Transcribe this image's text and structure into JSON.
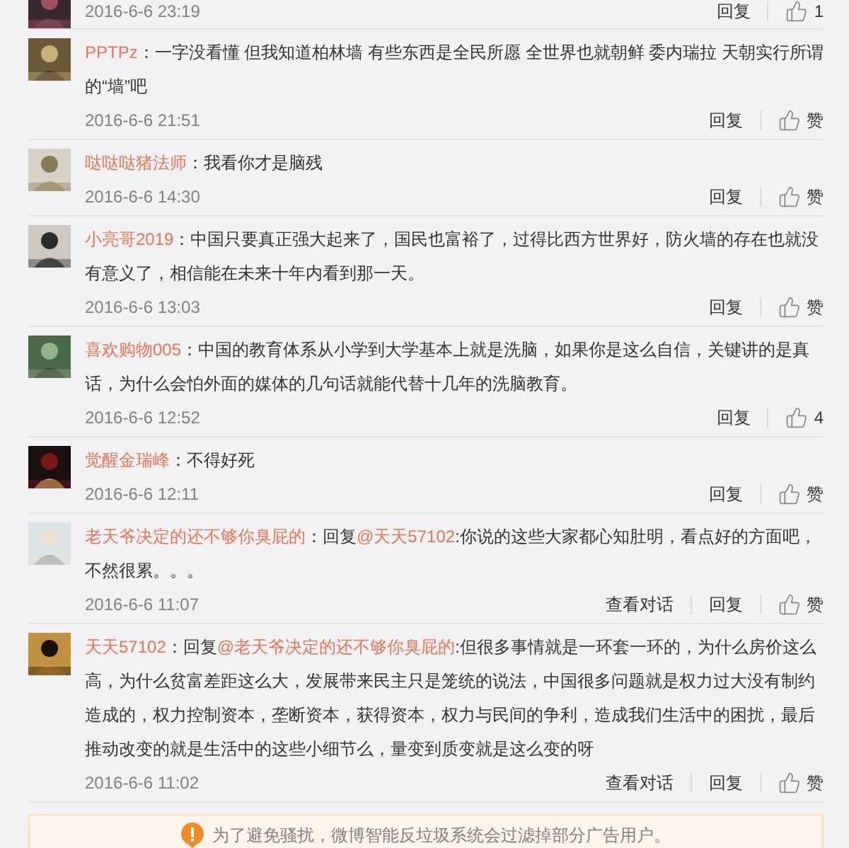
{
  "partial_comment": {
    "date": "2016-6-6 23:19",
    "reply": "回复",
    "like": "1"
  },
  "comments": [
    {
      "name": "PPTPz",
      "segments": [
        {
          "kind": "text",
          "text": "：一字没看懂 但我知道柏林墙 有些东西是全民所愿  全世界也就朝鲜 委内瑞拉 天朝实行所谓的“墙”吧"
        }
      ],
      "date": "2016-6-6 21:51",
      "reply": "回复",
      "like": "赞"
    },
    {
      "name": "哒哒哒猪法师",
      "segments": [
        {
          "kind": "text",
          "text": "：我看你才是脑残"
        }
      ],
      "date": "2016-6-6 14:30",
      "reply": "回复",
      "like": "赞"
    },
    {
      "name": "小亮哥2019",
      "segments": [
        {
          "kind": "text",
          "text": "：中国只要真正强大起来了，国民也富裕了，过得比西方世界好，防火墙的存在也就没有意义了，相信能在未来十年内看到那一天。"
        }
      ],
      "date": "2016-6-6 13:03",
      "reply": "回复",
      "like": "赞"
    },
    {
      "name": "喜欢购物005",
      "segments": [
        {
          "kind": "text",
          "text": "：中国的教育体系从小学到大学基本上就是洗脑，如果你是这么自信，关键讲的是真话，为什么会怕外面的媒体的几句话就能代替十几年的洗脑教育。"
        }
      ],
      "date": "2016-6-6 12:52",
      "reply": "回复",
      "like": "4"
    },
    {
      "name": "觉醒金瑞峰",
      "segments": [
        {
          "kind": "text",
          "text": "：不得好死"
        }
      ],
      "date": "2016-6-6 12:11",
      "reply": "回复",
      "like": "赞"
    },
    {
      "name": "老天爷决定的还不够你臭屁的",
      "segments": [
        {
          "kind": "text",
          "text": "：回复"
        },
        {
          "kind": "mention",
          "text": "@天天57102"
        },
        {
          "kind": "text",
          "text": ":你说的这些大家都心知肚明，看点好的方面吧，不然很累。。。"
        }
      ],
      "date": "2016-6-6 11:07",
      "conversation": "查看对话",
      "reply": "回复",
      "like": "赞"
    },
    {
      "name": "天天57102",
      "segments": [
        {
          "kind": "text",
          "text": "：回复"
        },
        {
          "kind": "mention",
          "text": "@老天爷决定的还不够你臭屁的"
        },
        {
          "kind": "text",
          "text": ":但很多事情就是一环套一环的，为什么房价这么高，为什么贫富差距这么大，发展带来民主只是笼统的说法，中国很多问题就是权力过大没有制约造成的，权力控制资本，垄断资本，获得资本，权力与民间的争利，造成我们生活中的困扰，最后推动改变的就是生活中的这些小细节么，量变到质变就是这么变的呀"
        }
      ],
      "date": "2016-6-6 11:02",
      "conversation": "查看对话",
      "reply": "回复",
      "like": "赞"
    }
  ],
  "notice": "为了避免骚扰，微博智能反垃圾系统会过滤掉部分广告用户。"
}
